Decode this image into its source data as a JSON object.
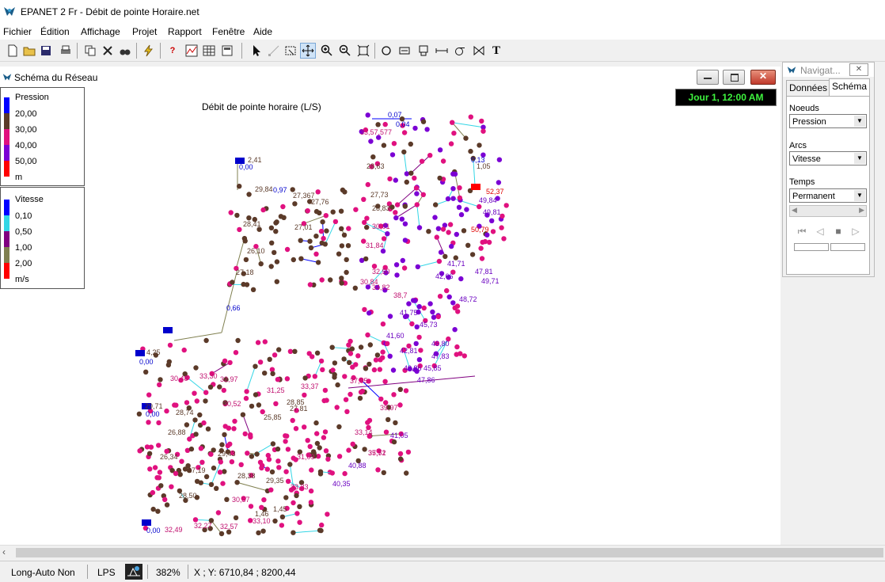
{
  "window": {
    "title": "EPANET 2 Fr - Débit de pointe Horaire.net"
  },
  "menu": [
    "Fichier",
    "Édition",
    "Affichage",
    "Projet",
    "Rapport",
    "Fenêtre",
    "Aide"
  ],
  "toolbar": {
    "buttons": [
      {
        "name": "new-file-icon"
      },
      {
        "name": "open-file-icon"
      },
      {
        "name": "save-icon"
      },
      {
        "name": "print-icon"
      },
      {
        "name": "copy-icon"
      },
      {
        "name": "delete-icon"
      },
      {
        "name": "find-icon"
      },
      {
        "name": "run-icon"
      },
      {
        "name": "query-icon"
      },
      {
        "name": "graph-icon"
      },
      {
        "name": "table-icon"
      },
      {
        "name": "options-icon"
      },
      {
        "name": "select-icon"
      },
      {
        "name": "select-vertex-icon"
      },
      {
        "name": "select-region-icon"
      },
      {
        "name": "pan-icon"
      },
      {
        "name": "zoom-in-icon"
      },
      {
        "name": "zoom-out-icon"
      },
      {
        "name": "full-extent-icon"
      },
      {
        "name": "add-junction-icon"
      },
      {
        "name": "add-reservoir-icon"
      },
      {
        "name": "add-tank-icon"
      },
      {
        "name": "add-pipe-icon"
      },
      {
        "name": "add-pump-icon"
      },
      {
        "name": "add-valve-icon"
      },
      {
        "name": "add-label-icon"
      }
    ],
    "label_text": "T"
  },
  "map_window": {
    "title": "Schéma du Réseau",
    "map_title": "Débit de pointe horaire (L/S)",
    "clock": "Jour 1, 12:00 AM"
  },
  "legend_pression": {
    "title": "Pression",
    "values": [
      "20,00",
      "30,00",
      "40,00",
      "50,00"
    ],
    "unit": "m",
    "colors": [
      "#0000ff",
      "#5b3a29",
      "#e0117f",
      "#7b00d4",
      "#ff0000"
    ]
  },
  "legend_vitesse": {
    "title": "Vitesse",
    "values": [
      "0,10",
      "0,50",
      "1,00",
      "2,00"
    ],
    "unit": "m/s",
    "colors": [
      "#0000ff",
      "#33d6e6",
      "#800080",
      "#808050",
      "#ff0000"
    ]
  },
  "map_labels": [
    "0,07",
    "0,04",
    "2,41",
    "0,00",
    "29,84",
    "0,97",
    "27,367",
    "27,76",
    "27,01",
    "28,41",
    "26,10",
    "27,18",
    "0,66",
    "33,57,577",
    "28,63",
    "27,73",
    "28,83",
    "31,84",
    "30,01",
    "32,50",
    "30,84",
    "34,82",
    "38,7",
    "41,75",
    "41,60",
    "42,81",
    "43,86",
    "45,85",
    "47,83",
    "47,86",
    "46,80",
    "45,73",
    "42,66",
    "41,71",
    "49,84",
    "49,81",
    "50,79",
    "48,72",
    "47,81",
    "49,71",
    "52,37",
    "1,05",
    "0,13",
    "4,25",
    "0,00",
    "0,00",
    "0,00",
    "28,74",
    "29,71",
    "30,48",
    "33,30",
    "32,97",
    "30,52",
    "31,25",
    "33,37",
    "37,95",
    "39,97",
    "37,51",
    "41,05",
    "40,88",
    "40,35",
    "33,33",
    "32,57",
    "33,10",
    "32,49",
    "32,27",
    "30,57",
    "28,38",
    "29,43",
    "26,34",
    "27,19",
    "28,50",
    "29,35",
    "31,09",
    "33,14",
    "35,72",
    "1,45",
    "1,46",
    "26,88",
    "28,85",
    "27,81",
    "25,85"
  ],
  "navigator": {
    "title": "Navigat...",
    "tabs": [
      "Données",
      "Schéma"
    ],
    "nodes_label": "Noeuds",
    "nodes_value": "Pression",
    "links_label": "Arcs",
    "links_value": "Vitesse",
    "time_label": "Temps",
    "time_value": "Permanent"
  },
  "status": {
    "auto_length": "Long-Auto  Non",
    "units": "LPS",
    "zoom": "382%",
    "coords": "X ; Y:  6710,84 ;  8200,44"
  }
}
